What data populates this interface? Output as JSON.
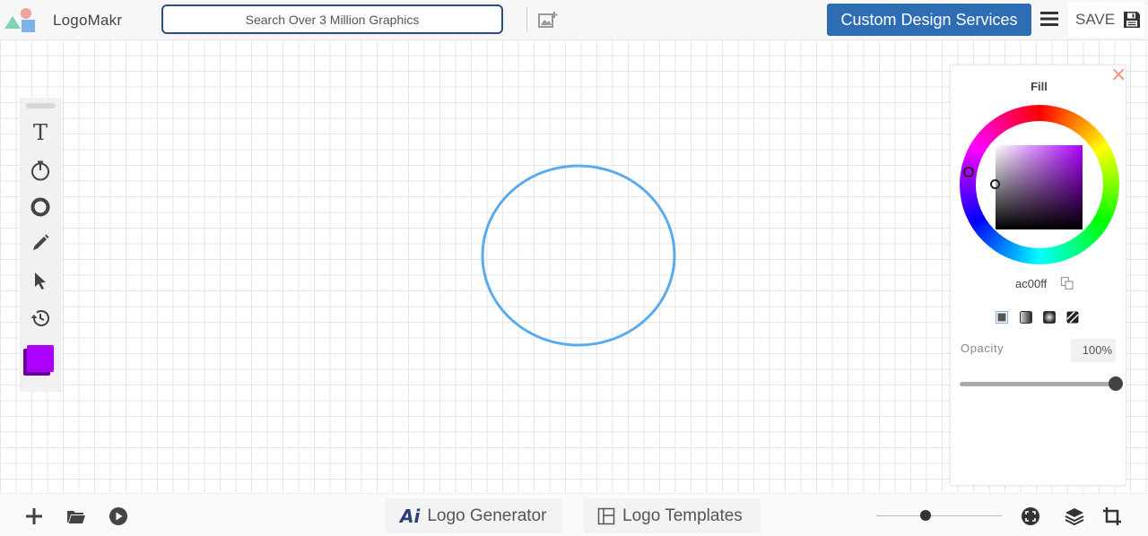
{
  "header": {
    "brand": "LogoMakr",
    "search_placeholder": "Search Over 3 Million Graphics",
    "cta_label": "Custom Design Services",
    "save_label": "SAVE"
  },
  "toolbar": {
    "text_tool_glyph": "T",
    "tools": [
      "text-icon",
      "timer-icon",
      "circle-shape-icon",
      "pencil-icon",
      "pointer-icon",
      "history-icon"
    ],
    "current_color": "#ac00ff"
  },
  "canvas": {
    "shape": "circle",
    "stroke_color": "#5aabee"
  },
  "fill_panel": {
    "title": "Fill",
    "close_glyph": "×",
    "hex_value": "ac00ff",
    "opacity_label": "Opacity",
    "opacity_value": "100%",
    "opacity_level": 1.0,
    "fill_types": [
      "solid",
      "linear-gradient",
      "radial-gradient",
      "pattern"
    ]
  },
  "bottom": {
    "logo_generator_label": "Logo Generator",
    "logo_generator_badge": "Ai",
    "logo_templates_label": "Logo Templates"
  },
  "colors": {
    "brand_blue": "#2e6db4",
    "search_border": "#2a4f86",
    "close_color": "#f0907a"
  }
}
